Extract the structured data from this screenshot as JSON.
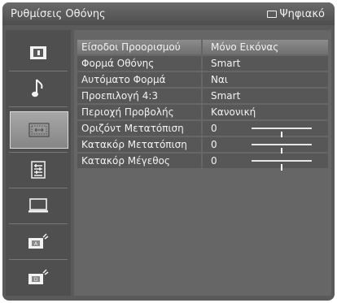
{
  "header": {
    "title": "Ρυθμίσεις Οθόνης",
    "source": "Ψηφιακό",
    "source_icon": "tv-icon"
  },
  "sidebar": {
    "items": [
      {
        "name": "picture-menu-icon"
      },
      {
        "name": "sound-menu-icon"
      },
      {
        "name": "screen-menu-icon",
        "selected": true
      },
      {
        "name": "setup-list-icon"
      },
      {
        "name": "pc-monitor-icon"
      },
      {
        "name": "analog-channel-icon"
      },
      {
        "name": "digital-channel-icon"
      }
    ]
  },
  "settings": [
    {
      "label": "Είσοδοι Προορισμού",
      "value": "Μόνο Εικόνας",
      "selected": true
    },
    {
      "label": "Φορμά Οθόνης",
      "value": "Smart"
    },
    {
      "label": "Αυτόματο Φορμά",
      "value": "Ναι"
    },
    {
      "label": "Προεπιλογή 4:3",
      "value": "Smart"
    },
    {
      "label": "Περιοχή Προβολής",
      "value": "Κανονική"
    },
    {
      "label": "Οριζόντ Μετατόπιση",
      "value": "0",
      "slider": 0.5
    },
    {
      "label": "Κατακόρ Μετατόπιση",
      "value": "0",
      "slider": 0.5
    },
    {
      "label": "Κατακόρ Μέγεθος",
      "value": "0",
      "slider": 0.5
    }
  ]
}
